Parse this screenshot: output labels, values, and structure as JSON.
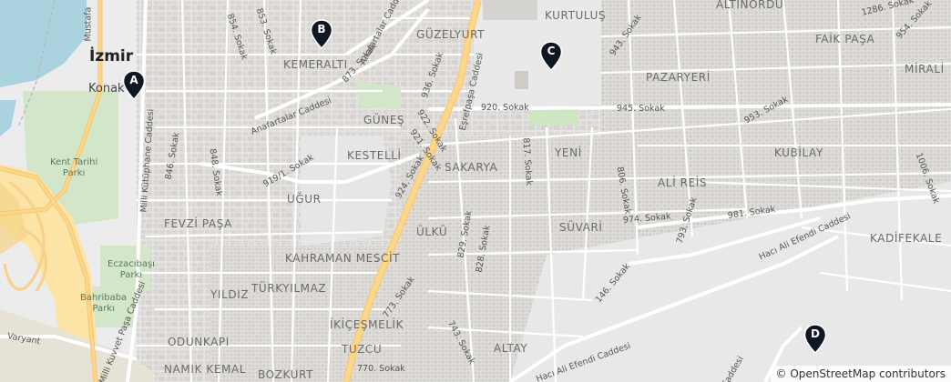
{
  "attribution": "© OpenStreetMap contributors",
  "city": {
    "name": "İzmir",
    "district": "Konak"
  },
  "neighborhoods": {
    "kemeralti": "KEMERALTI",
    "guzelyurt": "GÜZELYURT",
    "kurtulus": "KURTULUŞ",
    "altinordu": "ALTINORDU",
    "faikpasa": "FAİK PAŞA",
    "mirali": "MİRALİ",
    "pazaryeri": "PAZARYERİ",
    "gunes": "GÜNEŞ",
    "kestelli": "KESTELLİ",
    "sakarya": "SAKARYA",
    "yeni": "YENİ",
    "kubilay": "KUBİLAY",
    "alireis": "ALİ REİS",
    "ugur": "UĞUR",
    "fevzipasa": "FEVZİ PAŞA",
    "ulku": "ÜLKÜ",
    "suvari": "SÜVARİ",
    "kadifekale": "KADİFEKALE",
    "kahramanmescit": "KAHRAMAN MESCİT",
    "yildiz": "YILDIZ",
    "turkyilmaz": "TÜRKYILMAZ",
    "ikicesmelik": "İKİÇEŞMELİK",
    "odunkapi": "ODUNKAPI",
    "tuzcu": "TUZCU",
    "altay": "ALTAY",
    "namikkemal": "NAMIK KEMAL",
    "bozkurt": "BOZKURT"
  },
  "parks": {
    "kenttarihi": [
      "Kent Tarihi",
      "Parkı"
    ],
    "eczacibasi": [
      "Eczacıbaşı",
      "Parkı"
    ],
    "bahribaba": [
      "Bahribaba",
      "Parkı"
    ]
  },
  "streets": {
    "s854": "854. Sokak",
    "s853": "853. Sokak",
    "s873": "873. Sokak",
    "anafartalar1": "Anafartalar Caddesi",
    "anafartalar2": "Anafartalar Caddesi",
    "s936": "936. Sokak",
    "eşrefpasa": "Eşrefpaşa Caddesi",
    "s920": "920. Sokak",
    "s945": "945. Sokak",
    "s953": "953. Sokak",
    "s943": "943. Sokak",
    "s1286": "1286. Sokak",
    "s954": "954. Sokak",
    "s922": "922. Sokak",
    "s921": "921. Sokak",
    "s919": "919/1. Sokak",
    "s848": "848. Sokak",
    "s846": "846. Sokak",
    "millikutup": "Milli Kütüphane Caddesi",
    "s817": "817. Sokak",
    "s806": "806. Sokak",
    "s1006": "1006. Sokak",
    "s924": "924. Sokak",
    "s974": "974. Sokak",
    "s981": "981. Sokak",
    "s793": "793. Sokak",
    "s829": "829. Sokak",
    "s828": "828. Sokak",
    "haciali1": "Hacı Ali Efendi Caddesi",
    "haciali2": "Hacı Ali Efendi Caddesi",
    "s146": "146. Sokak",
    "s773": "773. Sokak",
    "s743": "743. Sokak",
    "s770": "770. Sokak",
    "varyant": "Varyant",
    "millikuvvet": "Milli Kuvvet Paşa Caddesi",
    "cadde": "Caddesi",
    "mustafa": "Mustafa"
  },
  "markers": [
    {
      "label": "A"
    },
    {
      "label": "B"
    },
    {
      "label": "C"
    },
    {
      "label": "D"
    }
  ],
  "colors": {
    "water": "#aad3df",
    "park": "#cde6c4",
    "road_major": "#fcd68a",
    "road_minor": "#ffffff",
    "building": "#d9d6d2",
    "land": "#eeeeee",
    "marker": "#0f1724"
  }
}
